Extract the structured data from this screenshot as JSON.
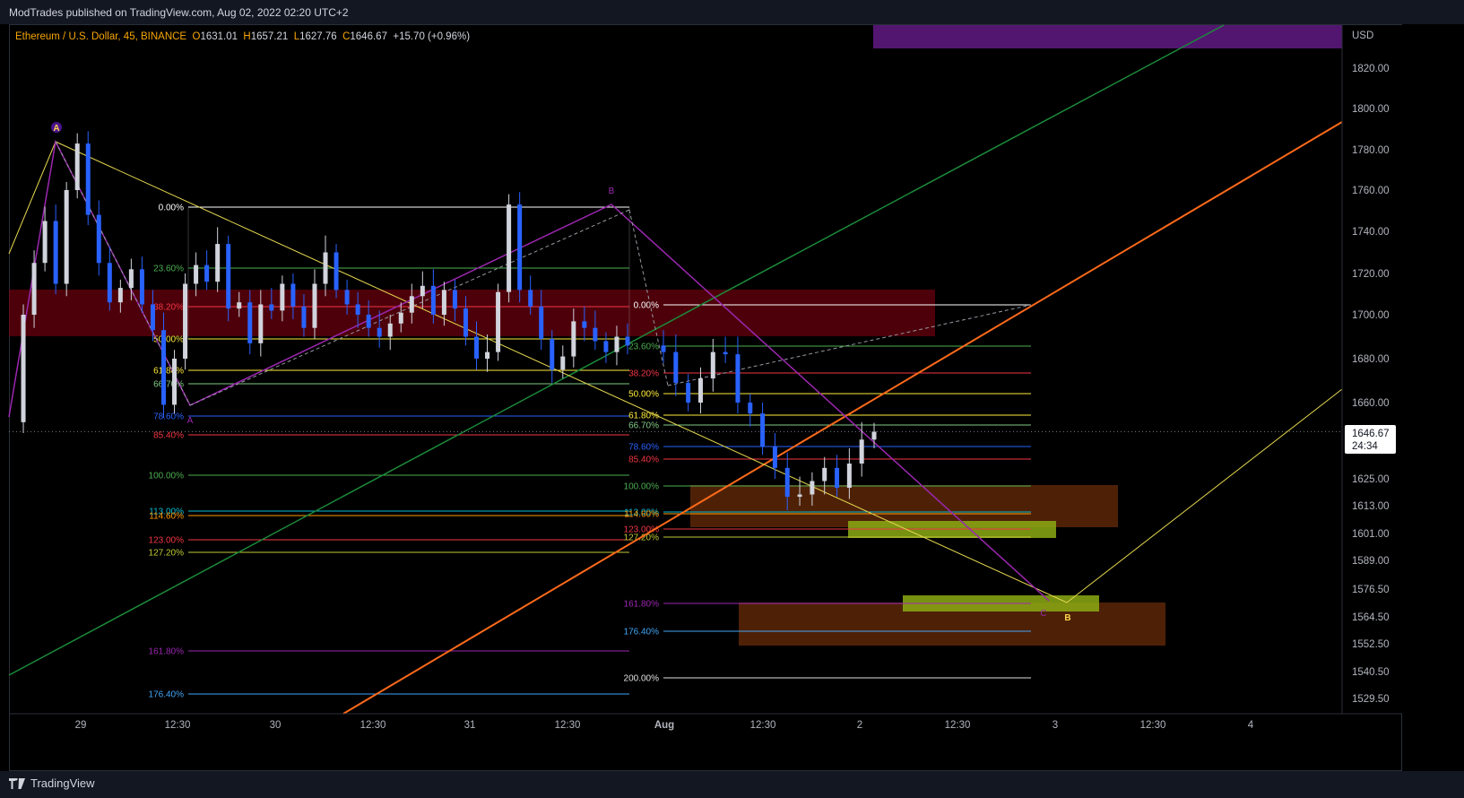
{
  "header": {
    "published": "ModTrades published on TradingView.com, Aug 02, 2022 02:20 UTC+2"
  },
  "legend": {
    "symbol": "Ethereum / U.S. Dollar, 45, BINANCE",
    "o_label": "O",
    "o": "1631.01",
    "h_label": "H",
    "h": "1657.21",
    "l_label": "L",
    "l": "1627.76",
    "c_label": "C",
    "c": "1646.67",
    "change": "+15.70 (+0.96%)"
  },
  "footer": {
    "brand": "TradingView"
  },
  "price_axis": {
    "currency": "USD",
    "ticks": [
      "1820.00",
      "1800.00",
      "1780.00",
      "1760.00",
      "1740.00",
      "1720.00",
      "1700.00",
      "1680.00",
      "1660.00",
      "1625.00",
      "1613.00",
      "1601.00",
      "1589.00",
      "1576.50",
      "1564.50",
      "1552.50",
      "1540.50",
      "1529.50"
    ],
    "last_price": "1646.67",
    "countdown": "24:34"
  },
  "time_axis": {
    "ticks": [
      "29",
      "12:30",
      "30",
      "12:30",
      "31",
      "12:30",
      "Aug",
      "12:30",
      "2",
      "12:30",
      "3",
      "12:30",
      "4"
    ]
  },
  "fib_left": [
    "0.00%",
    "23.60%",
    "38.20%",
    "50.00%",
    "61.80%",
    "66.70%",
    "78.60%",
    "85.40%",
    "100.00%",
    "113.00%",
    "114.60%",
    "123.00%",
    "127.20%",
    "161.80%",
    "176.40%"
  ],
  "fib_right": [
    "0.00%",
    "23.60%",
    "38.20%",
    "50.00%",
    "61.80%",
    "66.70%",
    "78.60%",
    "85.40%",
    "100.00%",
    "113.00%",
    "114.60%",
    "123.00%",
    "127.20%",
    "161.80%",
    "176.40%",
    "200.00%"
  ],
  "wave_labels": {
    "a_top": "A",
    "a_low": "A",
    "b_mid": "B",
    "c_end": "C",
    "b_end": "B"
  },
  "colors": {
    "fib_level_colors": [
      "#ffffff",
      "#4caf50",
      "#f23645",
      "#ffeb3b",
      "#ffeb3b",
      "#81c784",
      "#2962ff",
      "#f23645",
      "#4caf50",
      "#00bcd4",
      "#ff9800",
      "#f23645",
      "#c0ca33",
      "#9c27b0",
      "#42a5f5",
      "#e0e0e0"
    ]
  },
  "chart_data": {
    "type": "candlestick",
    "title": "Ethereum / U.S. Dollar, 45, BINANCE",
    "ylabel": "USD",
    "ylim": [
      1523,
      1833
    ],
    "x_range": [
      "Jul 28",
      "Aug 4"
    ],
    "last": 1646.67,
    "series_close_sketch": [
      1651,
      1700,
      1725,
      1745,
      1715,
      1760,
      1783,
      1748,
      1725,
      1706,
      1713,
      1722,
      1705,
      1693,
      1659,
      1680,
      1715,
      1724,
      1716,
      1734,
      1703,
      1706,
      1687,
      1705,
      1702,
      1715,
      1704,
      1694,
      1715,
      1730,
      1712,
      1705,
      1700,
      1694,
      1690,
      1696,
      1701,
      1709,
      1714,
      1700,
      1712,
      1703,
      1690,
      1680,
      1683,
      1711,
      1753,
      1712,
      1704,
      1689,
      1675,
      1681,
      1697,
      1694,
      1688,
      1683,
      1690,
      1686,
      1683,
      1669,
      1660,
      1671,
      1683,
      1682,
      1660,
      1655,
      1640,
      1630,
      1617,
      1618,
      1624,
      1630,
      1621,
      1632,
      1643,
      1646.67
    ]
  }
}
